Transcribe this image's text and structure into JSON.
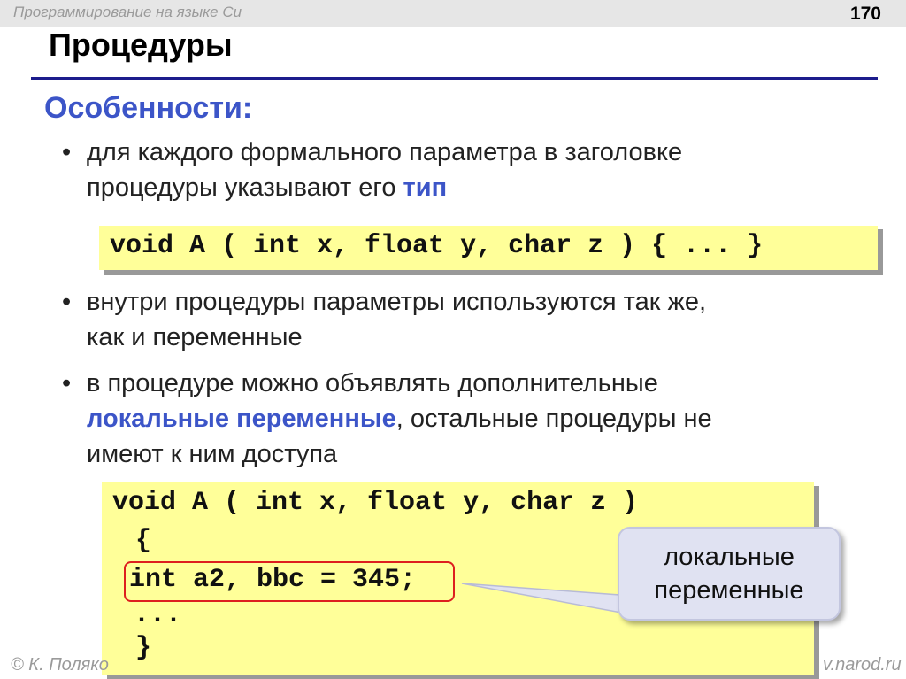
{
  "header": {
    "course": "Программирование на языке Си",
    "page_number": "170"
  },
  "title": "Процедуры",
  "subheading": "Особенности:",
  "bullets": [
    {
      "line1": "для каждого формального параметра в заголовке",
      "line2_plain": "процедуры указывают его ",
      "line2_highlight": "тип"
    },
    {
      "line1": "внутри процедуры параметры используются так же,",
      "line2": "как и переменные"
    },
    {
      "line1": "в процедуре можно объявлять дополнительные",
      "line2_highlight": "локальные переменные",
      "line2_plain": ", остальные процедуры не",
      "line3": "имеют к ним доступа"
    }
  ],
  "code_example_1": "void A ( int x, float y, char z ) { ... }",
  "code_example_2": {
    "signature": "void A ( int x, float y, char z )",
    "open_brace": "{",
    "local_decl": "int a2, bbc = 345;",
    "ellipsis": "...",
    "close_brace": "}"
  },
  "callout": {
    "line1": "локальные",
    "line2": "переменные"
  },
  "footer": {
    "left": "© К. Поляко",
    "right": "v.narod.ru"
  },
  "colors": {
    "accent": "#3c55c8",
    "rule": "#1c1c8c",
    "code_bg": "#ffff99",
    "highlight_border": "#dd1f1f",
    "callout_bg": "#e0e2f2"
  }
}
